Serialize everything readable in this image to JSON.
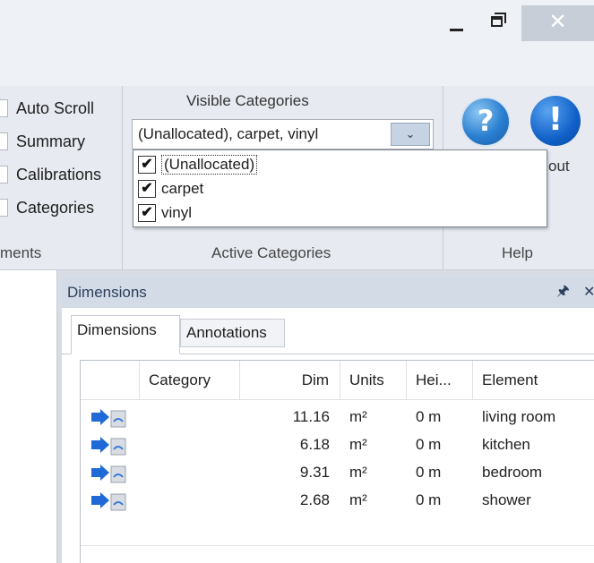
{
  "window": {
    "close_glyph": "✕"
  },
  "ribbon": {
    "view_group": {
      "items": [
        "Auto Scroll",
        "Summary",
        "Calibrations",
        "Categories"
      ],
      "group_label": "ments"
    },
    "categories_group": {
      "title": "Visible Categories",
      "combo_value": "(Unallocated), carpet, vinyl",
      "combo_arrow": "⌄",
      "options": [
        {
          "label": "(Unallocated)",
          "checked": true
        },
        {
          "label": "carpet",
          "checked": true
        },
        {
          "label": "vinyl",
          "checked": true
        }
      ],
      "check_glyph": "✔",
      "group_label": "Active Categories"
    },
    "help_group": {
      "help_glyph": "?",
      "about_glyph": "!",
      "about_label": "out",
      "group_label": "Help"
    }
  },
  "panel": {
    "title": "Dimensions",
    "pin_glyph": "📌",
    "close_glyph": "✕",
    "tabs": [
      "Dimensions",
      "Annotations"
    ],
    "active_tab": "Dimensions",
    "grid": {
      "columns": [
        "Category",
        "Dim",
        "Units",
        "Hei...",
        "Element"
      ],
      "rows": [
        {
          "category": "",
          "dim": "11.16",
          "units": "m²",
          "height": "0 m",
          "element": "living room"
        },
        {
          "category": "",
          "dim": "6.18",
          "units": "m²",
          "height": "0 m",
          "element": "kitchen"
        },
        {
          "category": "",
          "dim": "9.31",
          "units": "m²",
          "height": "0 m",
          "element": "bedroom"
        },
        {
          "category": "",
          "dim": "2.68",
          "units": "m²",
          "height": "0 m",
          "element": "shower"
        }
      ]
    }
  },
  "colors": {
    "ribbon_bg": "#e7ebf1",
    "panel_header": "#d3dbe6",
    "accent_blue": "#1a6fd0"
  }
}
